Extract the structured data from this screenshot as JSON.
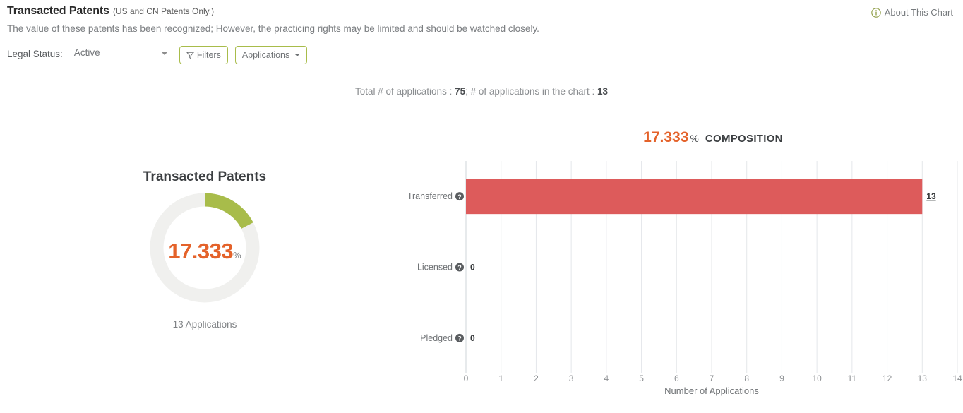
{
  "header": {
    "title": "Transacted Patents",
    "title_note": "(US and CN Patents Only.)",
    "about_label": "About This Chart",
    "about_icon": "info-circle-icon",
    "description": "The value of these patents has been recognized; However, the practicing rights may be limited and should be watched closely."
  },
  "filters": {
    "legal_status_label": "Legal Status:",
    "legal_status_value": "Active",
    "legal_status_options": [
      "Active"
    ],
    "filters_button": "Filters",
    "filters_icon": "funnel-icon",
    "applications_button": "Applications",
    "applications_caret": "caret-down-icon"
  },
  "summary": {
    "prefix": "Total # of applications : ",
    "total_applications": "75",
    "middle": "; # of applications in the chart : ",
    "chart_applications": "13"
  },
  "donut": {
    "title": "Transacted Patents",
    "percent": "17.333",
    "percent_symbol": "%",
    "caption": "13 Applications",
    "value": 17.333,
    "track_color": "#f0f0ee",
    "arc_color": "#a8bc4a",
    "text_color": "#e4622a"
  },
  "composition": {
    "percent": "17.333",
    "percent_symbol": "%",
    "label": "COMPOSITION"
  },
  "chart_data": {
    "type": "bar",
    "orientation": "horizontal",
    "title": "",
    "categories": [
      "Transferred",
      "Licensed",
      "Pledged"
    ],
    "values": [
      13,
      0,
      0
    ],
    "value_labels": [
      "13",
      "0",
      "0"
    ],
    "xlabel": "Number of Applications",
    "ylabel": "",
    "xlim": [
      0,
      14
    ],
    "xticks": [
      "0",
      "1",
      "2",
      "3",
      "4",
      "5",
      "6",
      "7",
      "8",
      "9",
      "10",
      "11",
      "12",
      "13",
      "14"
    ],
    "grid": true,
    "legend": "none",
    "bar_color": "#dd5b5b",
    "help_icon": "help-circle-icon",
    "help_icons": [
      "help-circle-icon",
      "help-circle-icon",
      "help-circle-icon"
    ]
  }
}
